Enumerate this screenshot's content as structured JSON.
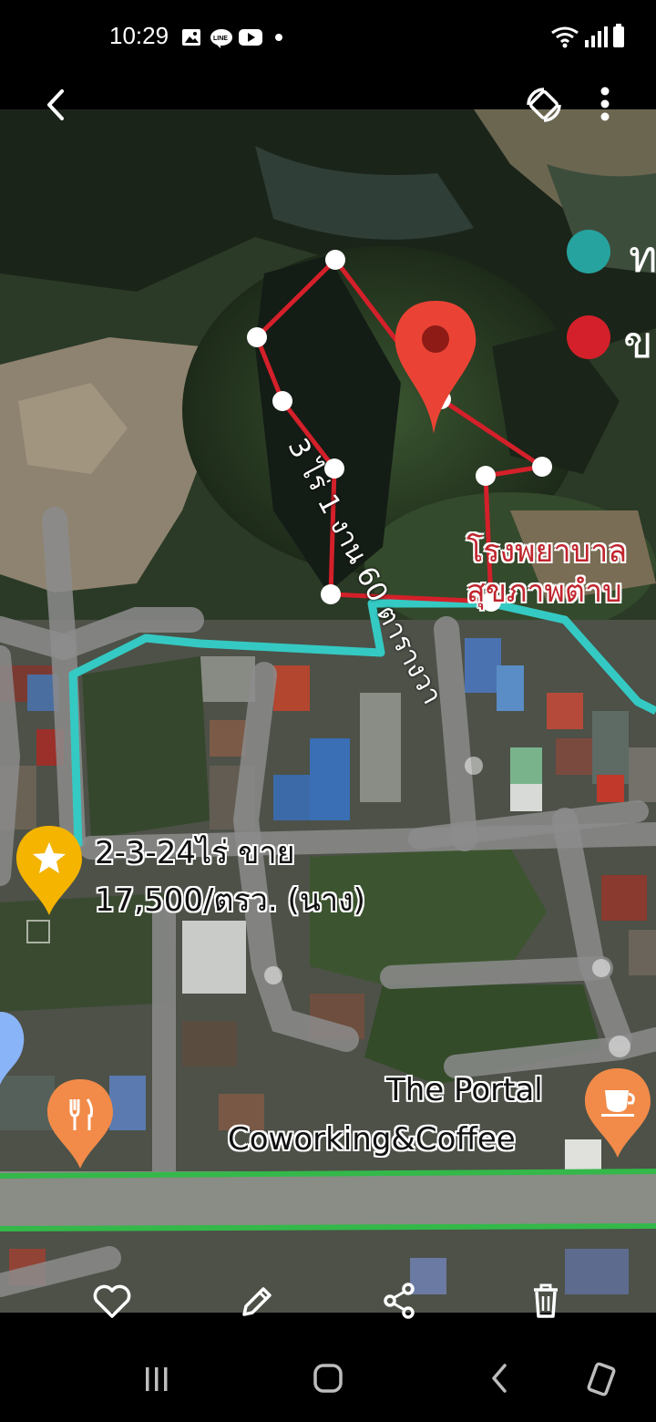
{
  "status_bar": {
    "time": "10:29",
    "left_icons": [
      "gallery-icon",
      "line-icon",
      "youtube-icon",
      "dot-icon"
    ],
    "right_icons": [
      "wifi-icon",
      "signal-icon",
      "battery-icon"
    ]
  },
  "viewer": {
    "back_icon": "chevron-left-icon",
    "rotate_icon": "rotate-icon",
    "more_icon": "more-vertical-icon"
  },
  "map": {
    "parcel_label": "3 ไร่ 1 งาน 60 ตารางวา",
    "hospital_label_line1": "โรงพยาบาล",
    "hospital_label_line2": "สุขภาพตำบ",
    "listing_line1": "2-3-24ไร่ ขาย",
    "listing_line2": "17,500/ตรว. (นาง)",
    "cafe_line1": "The Portal",
    "cafe_line2": "Coworking&Coffee",
    "legend_item1": "ท",
    "legend_item2": "ข",
    "colors": {
      "parcel": "#d4202a",
      "route": "#35c9c3",
      "road": "#34b84a",
      "pin": "#ea4335",
      "star_pin": "#f4b400",
      "food_pin": "#f28b49"
    }
  },
  "toolbar": {
    "favorite_icon": "heart-icon",
    "edit_icon": "pencil-icon",
    "share_icon": "share-icon",
    "delete_icon": "trash-icon"
  },
  "navbar": {
    "recent_icon": "recent-apps-icon",
    "home_icon": "home-icon",
    "back_icon": "back-icon",
    "rotate_icon": "screen-rotate-icon"
  }
}
